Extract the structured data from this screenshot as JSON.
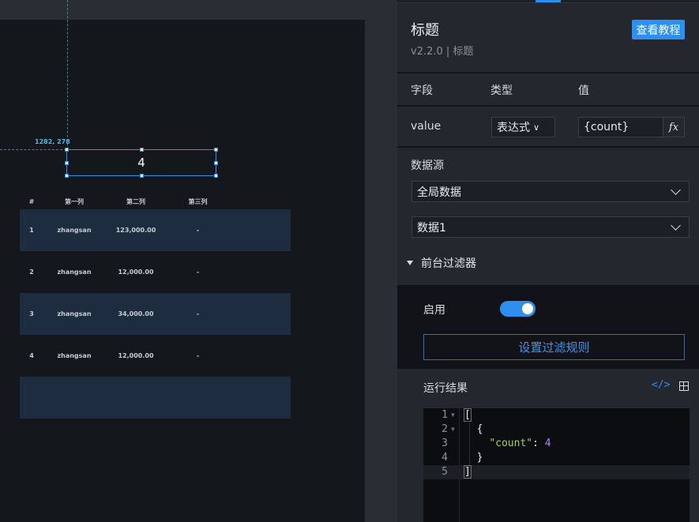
{
  "canvas": {
    "coord_readout": "1282, 278",
    "selected_value": "4",
    "table": {
      "headers": [
        "#",
        "第一列",
        "第二列",
        "第三列"
      ],
      "rows": [
        [
          "1",
          "zhangsan",
          "123,000.00",
          "-"
        ],
        [
          "2",
          "zhangsan",
          "12,000.00",
          "-"
        ],
        [
          "3",
          "zhangsan",
          "34,000.00",
          "-"
        ],
        [
          "4",
          "zhangsan",
          "12,000.00",
          "-"
        ]
      ]
    }
  },
  "panel": {
    "title": "标题",
    "version": "v2.2.0 | 标题",
    "tutorial_label": "查看教程",
    "field_headers": {
      "field": "字段",
      "type": "类型",
      "value": "值"
    },
    "field_row": {
      "name": "value",
      "type": "表达式",
      "expression": "{count}",
      "fx": "fx"
    },
    "datasource": {
      "label": "数据源",
      "scope": "全局数据",
      "dataset": "数据1"
    },
    "filter": {
      "title": "前台过滤器",
      "enable_label": "启用",
      "enabled": true,
      "rule_button": "设置过滤规则"
    },
    "result": {
      "label": "运行结果",
      "lines": [
        "1",
        "2",
        "3",
        "4",
        "5"
      ],
      "code": {
        "open_bracket": "[",
        "open_brace": "{",
        "key": "\"count\"",
        "colon": ": ",
        "value": "4",
        "close_brace": "}",
        "close_bracket": "]"
      }
    }
  },
  "colors": {
    "accent": "#2f8ff0",
    "row_stripe": "#1d2d3f",
    "string": "#9bd35a",
    "number": "#b083f0"
  }
}
